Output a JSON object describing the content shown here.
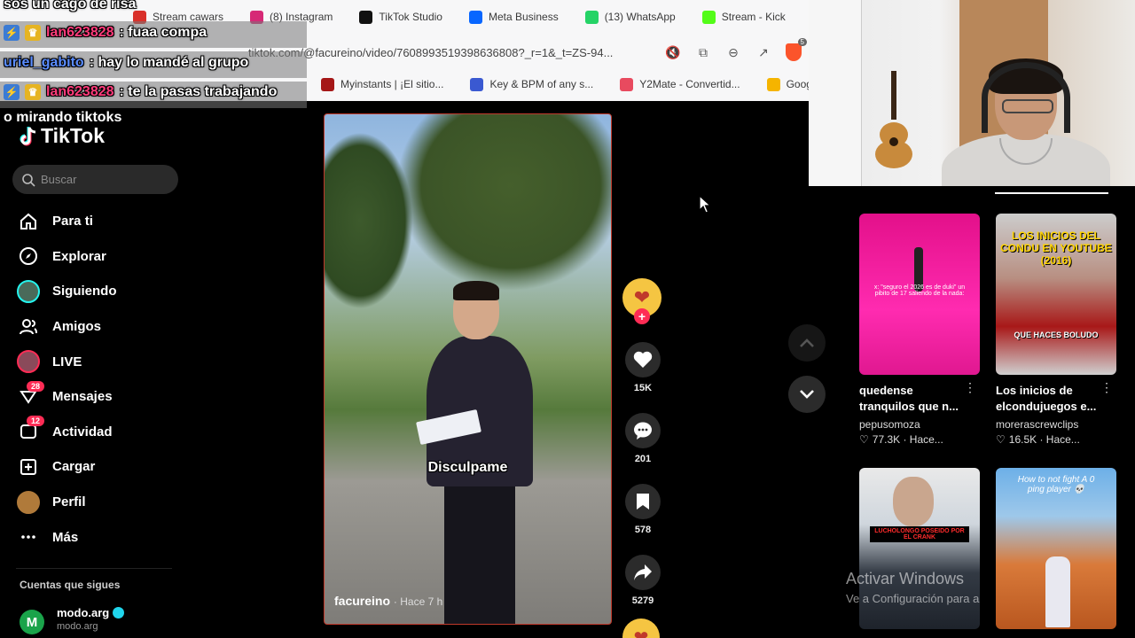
{
  "browser": {
    "top_bookmarks": [
      {
        "label": "Stream cawars",
        "color": "#d9302a"
      },
      {
        "label": "(8) Instagram",
        "color": "#d62976"
      },
      {
        "label": "TikTok Studio",
        "color": "#111111"
      },
      {
        "label": "Meta Business",
        "color": "#0866ff"
      },
      {
        "label": "(13) WhatsApp",
        "color": "#25d366"
      },
      {
        "label": "Stream - Kick",
        "color": "#53fc18"
      }
    ],
    "url": "tiktok.com/@facureino/video/7608993519398636808?_r=1&_t=ZS-94...",
    "bottom_bookmarks": [
      {
        "label": "Myinstants | ¡El sitio...",
        "color": "#a51717"
      },
      {
        "label": "Key & BPM of any s...",
        "color": "#3a59d1"
      },
      {
        "label": "Y2Mate - Convertid...",
        "color": "#e84a5f"
      },
      {
        "label": "Google Kee",
        "color": "#f5b400"
      }
    ]
  },
  "chat": {
    "header_text": "sos un cago de risa",
    "messages": [
      {
        "user": "lan623828",
        "text": ": fuaa compa",
        "user_color": "#ff3b7a"
      },
      {
        "user": "uriel_gabito",
        "text": ": hay lo mandé al grupo",
        "user_color": "#5a8cff"
      },
      {
        "user": "lan623828",
        "text": ": te la pasas trabajando",
        "user_color": "#ff3b7a"
      }
    ],
    "continuation": "o mirando tiktoks"
  },
  "sidebar": {
    "logo": "TikTok",
    "search_placeholder": "Buscar",
    "items": [
      {
        "label": "Para ti",
        "icon": "home-icon"
      },
      {
        "label": "Explorar",
        "icon": "compass-icon"
      },
      {
        "label": "Siguiendo",
        "icon": "following-avatar-icon"
      },
      {
        "label": "Amigos",
        "icon": "friends-icon"
      },
      {
        "label": "LIVE",
        "icon": "live-avatar-icon"
      },
      {
        "label": "Mensajes",
        "icon": "messages-icon",
        "badge": "28"
      },
      {
        "label": "Actividad",
        "icon": "activity-icon",
        "badge": "12"
      },
      {
        "label": "Cargar",
        "icon": "upload-icon"
      },
      {
        "label": "Perfil",
        "icon": "profile-avatar-icon"
      },
      {
        "label": "Más",
        "icon": "more-icon"
      }
    ],
    "following_title": "Cuentas que sigues",
    "following_account": {
      "name": "modo.arg",
      "handle": "modo.arg",
      "initial": "M"
    }
  },
  "video": {
    "caption": "Disculpame",
    "author": "facureino",
    "time": "· Hace 7 h"
  },
  "actions": {
    "likes": "15K",
    "comments": "201",
    "saves": "578",
    "shares": "5279"
  },
  "recommendations": [
    {
      "title": "quedense tranquilos que n...",
      "author": "pepusomoza",
      "stats": "77.3K · Hace...",
      "thumb_text": "x: \"seguro el 2026 es de duki\" un pibito de 17 saliendo de la nada:"
    },
    {
      "title": "Los inicios de elcondujuegos e...",
      "author": "morerascrewclips",
      "stats": "16.5K · Hace...",
      "thumb_text": "LOS INICIOS DEL CONDU EN YOUTUBE (2016)",
      "thumb_text_2": "QUE HACES BOLUDO"
    },
    {
      "title": "",
      "author": "",
      "stats": "",
      "thumb_text": "LUCHOLONGO POSEIDO POR EL CRANK"
    },
    {
      "title": "",
      "author": "",
      "stats": "",
      "thumb_text": "How to not fight A 0 ping player 💀"
    }
  ],
  "windows_activation": {
    "title": "Activar Windows",
    "subtitle": "Ve a Configuración para a"
  }
}
